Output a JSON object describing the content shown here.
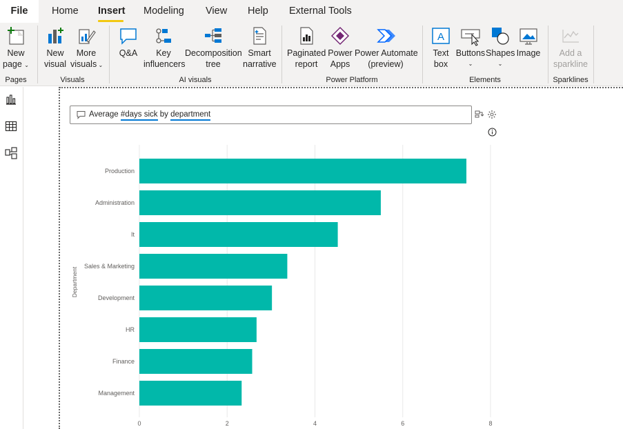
{
  "menu": {
    "file": "File",
    "tabs": [
      "Home",
      "Insert",
      "Modeling",
      "View",
      "Help",
      "External Tools"
    ],
    "active": "Insert"
  },
  "ribbon": {
    "pages": {
      "label": "Pages",
      "new_page": [
        "New",
        "page"
      ]
    },
    "visuals": {
      "label": "Visuals",
      "new_visual": [
        "New",
        "visual"
      ],
      "more_visuals": [
        "More",
        "visuals"
      ]
    },
    "ai": {
      "label": "AI visuals",
      "qa": "Q&A",
      "key_influencers": [
        "Key",
        "influencers"
      ],
      "decomposition_tree": [
        "Decomposition",
        "tree"
      ],
      "smart_narrative": [
        "Smart",
        "narrative"
      ]
    },
    "power_platform": {
      "label": "Power Platform",
      "paginated_report": [
        "Paginated",
        "report"
      ],
      "power_apps": [
        "Power",
        "Apps"
      ],
      "power_automate": [
        "Power Automate",
        "(preview)"
      ]
    },
    "elements": {
      "label": "Elements",
      "text_box": [
        "Text",
        "box"
      ],
      "buttons": "Buttons",
      "shapes": "Shapes",
      "image": "Image"
    },
    "sparklines": {
      "label": "Sparklines",
      "add_sparkline": [
        "Add a",
        "sparkline"
      ]
    }
  },
  "left_rail": {
    "icons": [
      "report-view-icon",
      "data-view-icon",
      "model-view-icon"
    ]
  },
  "qna": {
    "parts": [
      "Average ",
      "#days sick",
      " by ",
      "department"
    ]
  },
  "colors": {
    "bar": "#01b8aa",
    "accent_underline": "#f2c811",
    "link": "#0078d4"
  },
  "chart_data": {
    "type": "bar",
    "orientation": "horizontal",
    "categories": [
      "Production",
      "Administration",
      "It",
      "Sales & Marketing",
      "Development",
      "HR",
      "Finance",
      "Management"
    ],
    "values": [
      7.45,
      5.5,
      4.52,
      3.37,
      3.02,
      2.67,
      2.57,
      2.33
    ],
    "ylabel": "Department",
    "xlim": [
      0,
      8
    ],
    "xticks": [
      "0",
      "2",
      "4",
      "6",
      "8"
    ],
    "grid": true
  }
}
